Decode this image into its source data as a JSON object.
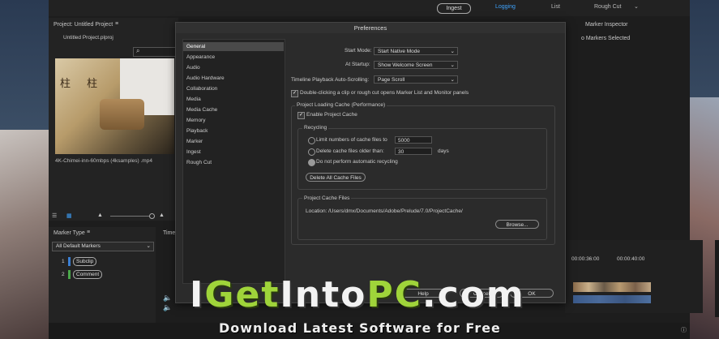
{
  "topbar": {
    "ingest": "Ingest",
    "logging": "Logging",
    "list": "List",
    "rough_cut": "Rough Cut",
    "chevron": "⌄"
  },
  "project_panel": {
    "title": "Project: Untitled Project",
    "menu_icon": "≡",
    "file": "Untitled Project.plproj",
    "search_icon": "⌕",
    "clip_caption": "4K-Chimei-inn-60mbps (4ksamples) .mp4",
    "thumb_chars": "柱 柱"
  },
  "marker_inspector": {
    "title": "Marker Inspector",
    "empty": "o Markers Selected"
  },
  "marker_panel": {
    "title": "Marker Type",
    "menu_icon": "≡",
    "dropdown": "All Default Markers",
    "items": [
      {
        "num": "1",
        "label": "Subclip"
      },
      {
        "num": "2",
        "label": "Comment"
      }
    ]
  },
  "time_tab": "Time",
  "timeline": {
    "tc1": "00:00:36:00",
    "tc2": "00:00:40:00"
  },
  "dialog": {
    "title": "Preferences",
    "sidebar": [
      "General",
      "Appearance",
      "Audio",
      "Audio Hardware",
      "Collaboration",
      "Media",
      "Media Cache",
      "Memory",
      "Playback",
      "Marker",
      "Ingest",
      "Rough Cut"
    ],
    "selected": "General",
    "start_mode_label": "Start Mode:",
    "start_mode_value": "Start Native Mode",
    "at_startup_label": "At Startup:",
    "at_startup_value": "Show Welcome Screen",
    "autoscroll_label": "Timeline Playback Auto-Scrolling:",
    "autoscroll_value": "Page Scroll",
    "double_click_label": "Double-clicking a clip or rough cut opens Marker List and Monitor panels",
    "cache_group": "Project Loading Cache (Performance)",
    "enable_cache": "Enable Project Cache",
    "recycling": "Recycling",
    "limit_label": "Limit numbers of cache files to",
    "limit_value": "5000",
    "delete_label": "Delete cache files older than:",
    "delete_value": "30",
    "days": "days",
    "no_recycle": "Do not perform automatic recycling",
    "delete_all": "Delete All Cache Files",
    "cache_files": "Project Cache Files",
    "location_label": "Location:",
    "location_value": "/Users/dmx/Documents/Adobe/Prelude/7.0/ProjectCache/",
    "browse": "Browse...",
    "help": "Help",
    "cancel": "Cancel",
    "ok": "OK"
  },
  "watermark": {
    "big": "IGetIntoPC.com",
    "part1": "I",
    "part2": "Get",
    "part3": "Into",
    "part4": "PC",
    "part5": ".com",
    "small": "Download Latest Software for Free"
  }
}
